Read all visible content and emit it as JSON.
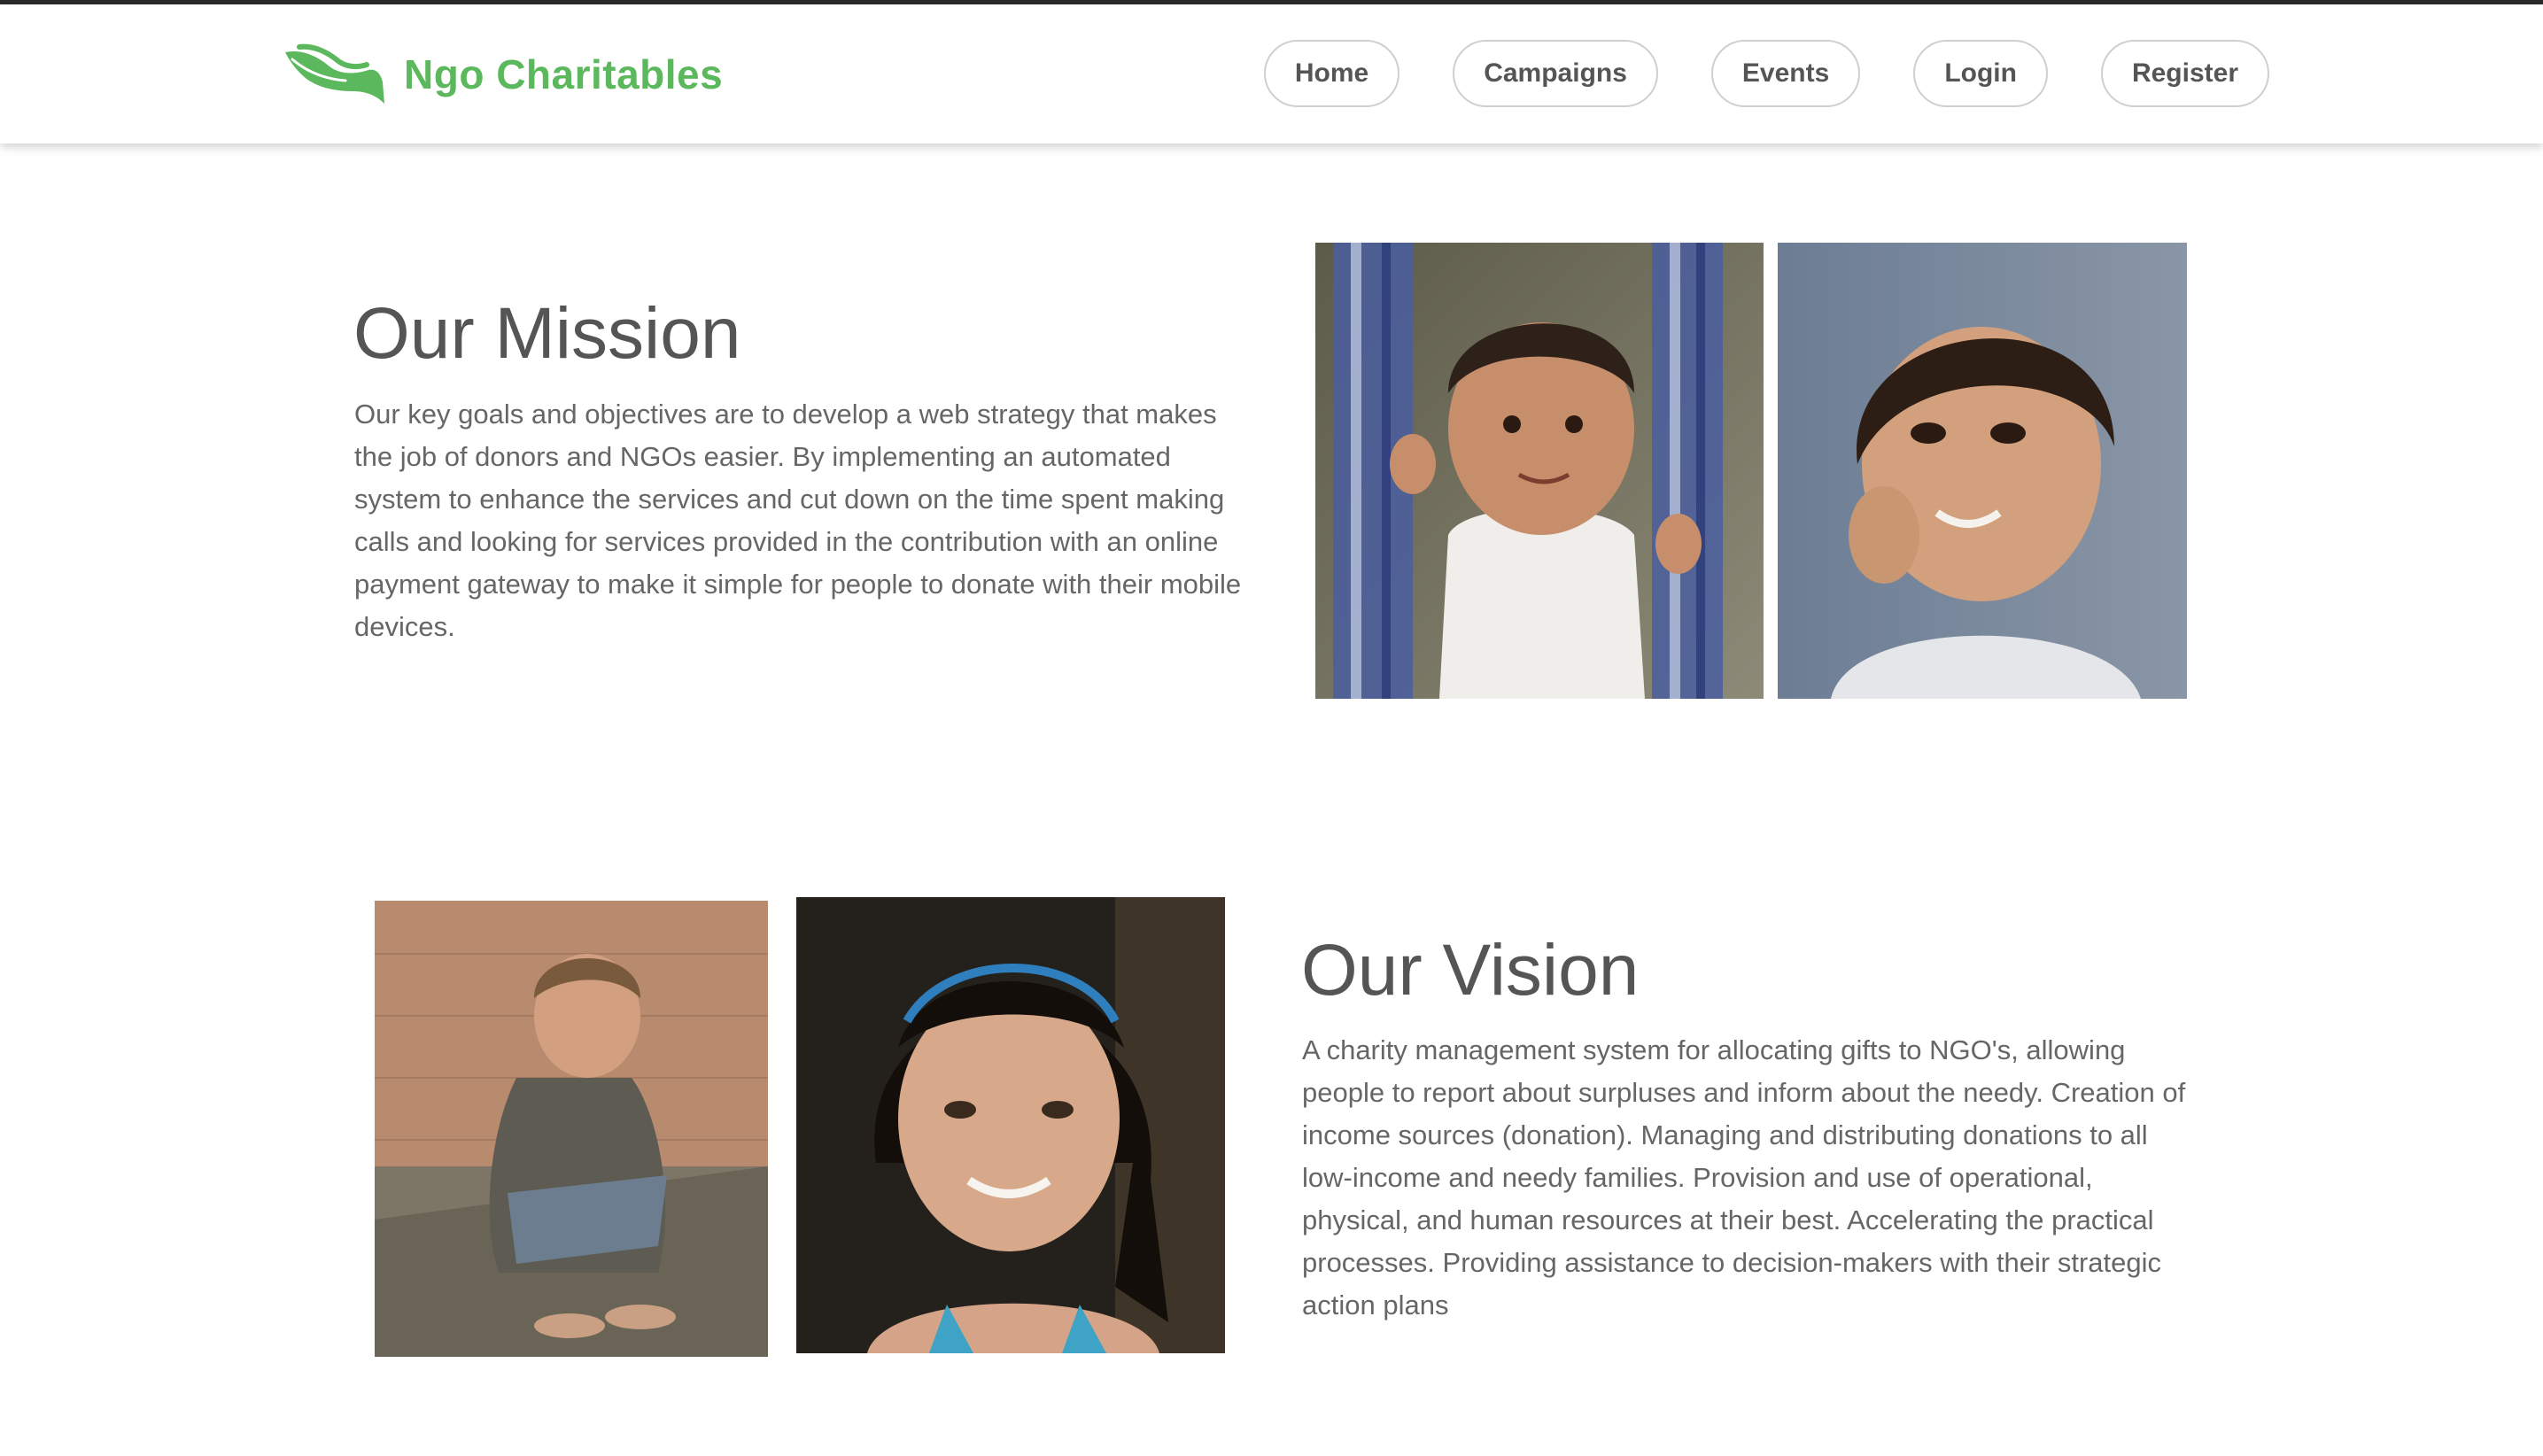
{
  "brand": {
    "name": "Ngo Charitables",
    "logo_icon": "hand-leaf-icon",
    "color": "#5cb85c"
  },
  "nav": {
    "items": [
      {
        "label": "Home"
      },
      {
        "label": "Campaigns"
      },
      {
        "label": "Events"
      },
      {
        "label": "Login"
      },
      {
        "label": "Register"
      }
    ]
  },
  "mission": {
    "title": "Our Mission",
    "text": "Our key goals and objectives are to develop a web strategy that makes the job of donors and NGOs easier. By implementing an automated system to enhance the services and cut down on the time spent making calls and looking for services provided in the contribution with an online payment gateway to make it simple for people to donate with their mobile devices."
  },
  "vision": {
    "title": "Our Vision",
    "text": "A charity management system for allocating gifts to NGO's, allowing people to report about surpluses and inform about the needy. Creation of income sources (donation). Managing and distributing donations to all low-income and needy families. Provision and use of operational, physical, and human resources at their best. Accelerating the practical processes. Providing assistance to decision-makers with their strategic action plans"
  }
}
